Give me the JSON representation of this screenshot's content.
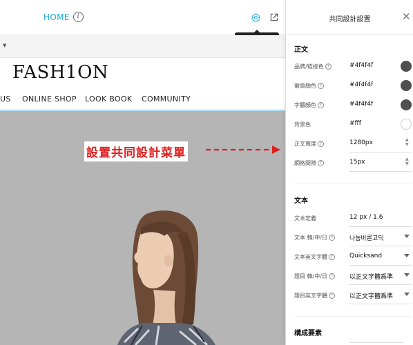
{
  "toolbar": {
    "home_label": "HOME",
    "tooltip": "共同設計設置"
  },
  "site": {
    "logo": "FASH1ON",
    "nav": [
      "US",
      "ONLINE SHOP",
      "LOOK BOOK",
      "COMMUNITY"
    ]
  },
  "hero": {
    "label": "設置共同設計菜單"
  },
  "panel": {
    "title": "共同設計設置",
    "sections": {
      "body": {
        "title": "正文",
        "rows": {
          "brand_link_color": {
            "label": "品牌/链接色",
            "value": "#4f4f4f"
          },
          "badge_color": {
            "label": "徽章顏色",
            "value": "#4f4f4f"
          },
          "text_color": {
            "label": "字體顏色",
            "value": "#4f4f4f"
          },
          "bg_color": {
            "label": "背景色",
            "value": "#fff"
          },
          "content_width": {
            "label": "正文寬度",
            "value": "1280px"
          },
          "grid_gap": {
            "label": "網格間隙",
            "value": "15px"
          }
        }
      },
      "text": {
        "title": "文本",
        "rows": {
          "text_def": {
            "label": "文本定義",
            "value": "12 px / 1.6"
          },
          "text_kcj": {
            "label": "文本 韓/中/日",
            "value": "나눔바른고딕"
          },
          "text_en_font": {
            "label": "文本英文字體",
            "value": "Quicksand"
          },
          "title_kcj": {
            "label": "題目 韓/中/日",
            "value": "以正文字體爲準"
          },
          "title_en_font": {
            "label": "題目英文字體",
            "value": "以正文字體爲準"
          }
        }
      },
      "elements": {
        "title": "構成要素"
      }
    }
  },
  "colors": {
    "accent": "#1fa7e1",
    "dark_swatch": "#4f4f4f",
    "white_swatch": "#ffffff",
    "highlight_red": "#e01e1e"
  }
}
